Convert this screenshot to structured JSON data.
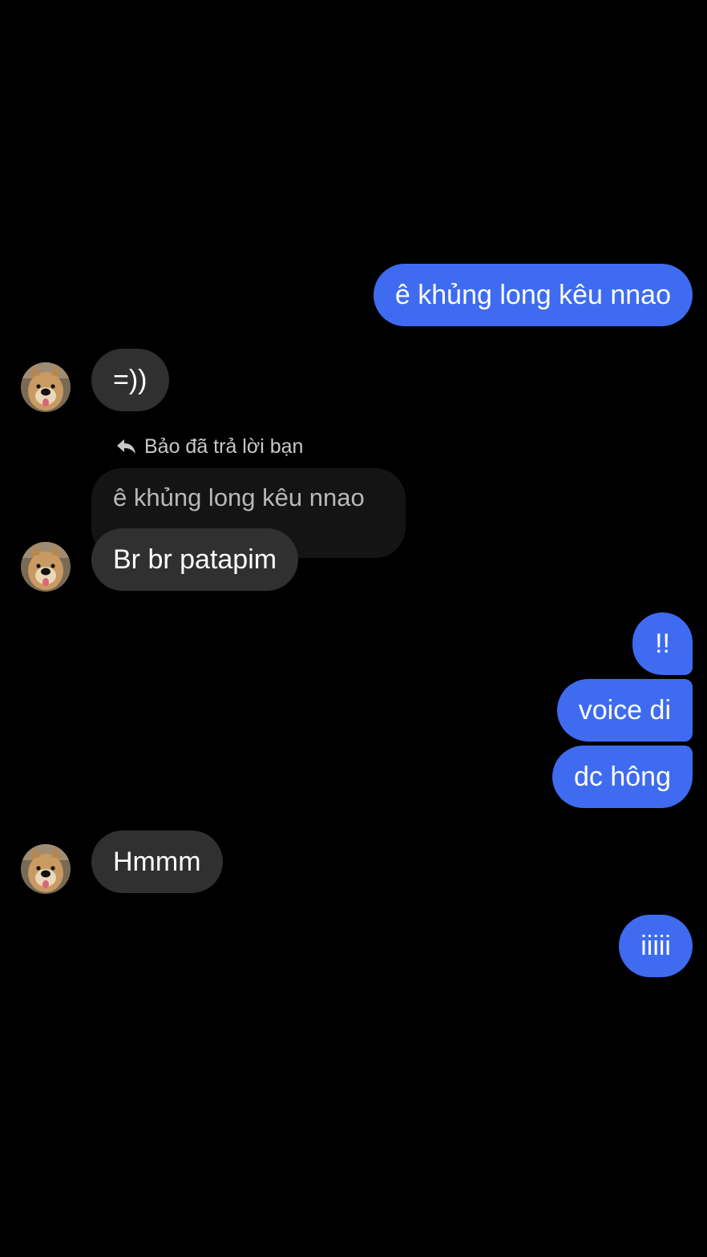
{
  "conversation": {
    "messages": [
      {
        "id": "m1",
        "direction": "outgoing",
        "text": "ê khủng long kêu nnao"
      },
      {
        "id": "m2",
        "direction": "incoming",
        "text": "=))"
      },
      {
        "id": "m3",
        "direction": "incoming",
        "reply_label": "Bảo đã trả lời bạn",
        "quoted_text": "ê khủng long kêu nnao",
        "text": "Br br patapim"
      },
      {
        "id": "m4",
        "direction": "outgoing",
        "text": "!!"
      },
      {
        "id": "m5",
        "direction": "outgoing",
        "text": "voice di"
      },
      {
        "id": "m6",
        "direction": "outgoing",
        "text": "dc hông"
      },
      {
        "id": "m7",
        "direction": "incoming",
        "text": "Hmmm"
      },
      {
        "id": "m8",
        "direction": "outgoing",
        "text": "iiiii"
      }
    ]
  },
  "theme": {
    "background": "#000000",
    "outgoing_bubble": "#3e6bf0",
    "incoming_bubble": "#303030",
    "quoted_bubble": "#141414"
  },
  "icons": {
    "reply": "reply-arrow-icon",
    "avatar": "dog-avatar"
  }
}
